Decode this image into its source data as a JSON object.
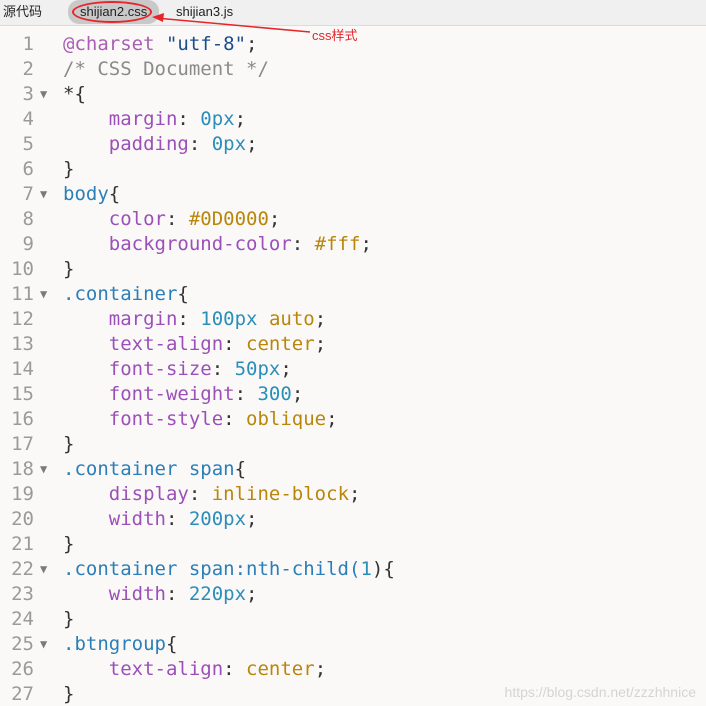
{
  "tabs": [
    {
      "label": "源代码",
      "active": false
    },
    {
      "label": "shijian2.css",
      "active": true
    },
    {
      "label": "shijian3.js",
      "active": false
    }
  ],
  "annotation": {
    "label": "css样式",
    "color": "#e5262b"
  },
  "watermark": "https://blog.csdn.net/zzzhhnice",
  "lines": [
    {
      "n": "1",
      "fold": false,
      "tokens": [
        {
          "t": "@charset ",
          "c": "at"
        },
        {
          "t": "\"utf-8\"",
          "c": "str"
        },
        {
          "t": ";",
          "c": "punc"
        }
      ]
    },
    {
      "n": "2",
      "fold": false,
      "tokens": [
        {
          "t": "/* CSS Document */",
          "c": "cmt"
        }
      ]
    },
    {
      "n": "3",
      "fold": true,
      "tokens": [
        {
          "t": "*{",
          "c": "punc"
        }
      ]
    },
    {
      "n": "4",
      "fold": false,
      "tokens": [
        {
          "t": "    margin",
          "c": "prop"
        },
        {
          "t": ": ",
          "c": "punc"
        },
        {
          "t": "0px",
          "c": "num"
        },
        {
          "t": ";",
          "c": "punc"
        }
      ]
    },
    {
      "n": "5",
      "fold": false,
      "tokens": [
        {
          "t": "    padding",
          "c": "prop"
        },
        {
          "t": ": ",
          "c": "punc"
        },
        {
          "t": "0px",
          "c": "num"
        },
        {
          "t": ";",
          "c": "punc"
        }
      ]
    },
    {
      "n": "6",
      "fold": false,
      "tokens": [
        {
          "t": "}",
          "c": "punc"
        }
      ]
    },
    {
      "n": "7",
      "fold": true,
      "tokens": [
        {
          "t": "body",
          "c": "sel"
        },
        {
          "t": "{",
          "c": "punc"
        }
      ]
    },
    {
      "n": "8",
      "fold": false,
      "tokens": [
        {
          "t": "    color",
          "c": "prop"
        },
        {
          "t": ": ",
          "c": "punc"
        },
        {
          "t": "#0D0000",
          "c": "kw"
        },
        {
          "t": ";",
          "c": "punc"
        }
      ]
    },
    {
      "n": "9",
      "fold": false,
      "tokens": [
        {
          "t": "    background-color",
          "c": "prop"
        },
        {
          "t": ": ",
          "c": "punc"
        },
        {
          "t": "#fff",
          "c": "kw"
        },
        {
          "t": ";",
          "c": "punc"
        }
      ]
    },
    {
      "n": "10",
      "fold": false,
      "tokens": [
        {
          "t": "}",
          "c": "punc"
        }
      ]
    },
    {
      "n": "11",
      "fold": true,
      "tokens": [
        {
          "t": ".container",
          "c": "sel"
        },
        {
          "t": "{",
          "c": "punc"
        }
      ]
    },
    {
      "n": "12",
      "fold": false,
      "tokens": [
        {
          "t": "    margin",
          "c": "prop"
        },
        {
          "t": ": ",
          "c": "punc"
        },
        {
          "t": "100px",
          "c": "num"
        },
        {
          "t": " ",
          "c": "punc"
        },
        {
          "t": "auto",
          "c": "kw"
        },
        {
          "t": ";",
          "c": "punc"
        }
      ]
    },
    {
      "n": "13",
      "fold": false,
      "tokens": [
        {
          "t": "    text-align",
          "c": "prop"
        },
        {
          "t": ": ",
          "c": "punc"
        },
        {
          "t": "center",
          "c": "kw"
        },
        {
          "t": ";",
          "c": "punc"
        }
      ]
    },
    {
      "n": "14",
      "fold": false,
      "tokens": [
        {
          "t": "    font-size",
          "c": "prop"
        },
        {
          "t": ": ",
          "c": "punc"
        },
        {
          "t": "50px",
          "c": "num"
        },
        {
          "t": ";",
          "c": "punc"
        }
      ]
    },
    {
      "n": "15",
      "fold": false,
      "tokens": [
        {
          "t": "    font-weight",
          "c": "prop"
        },
        {
          "t": ": ",
          "c": "punc"
        },
        {
          "t": "300",
          "c": "num"
        },
        {
          "t": ";",
          "c": "punc"
        }
      ]
    },
    {
      "n": "16",
      "fold": false,
      "tokens": [
        {
          "t": "    font-style",
          "c": "prop"
        },
        {
          "t": ": ",
          "c": "punc"
        },
        {
          "t": "oblique",
          "c": "kw"
        },
        {
          "t": ";",
          "c": "punc"
        }
      ]
    },
    {
      "n": "17",
      "fold": false,
      "tokens": [
        {
          "t": "}",
          "c": "punc"
        }
      ]
    },
    {
      "n": "18",
      "fold": true,
      "tokens": [
        {
          "t": ".container span",
          "c": "sel"
        },
        {
          "t": "{",
          "c": "punc"
        }
      ]
    },
    {
      "n": "19",
      "fold": false,
      "tokens": [
        {
          "t": "    display",
          "c": "prop"
        },
        {
          "t": ": ",
          "c": "punc"
        },
        {
          "t": "inline-block",
          "c": "kw"
        },
        {
          "t": ";",
          "c": "punc"
        }
      ]
    },
    {
      "n": "20",
      "fold": false,
      "tokens": [
        {
          "t": "    width",
          "c": "prop"
        },
        {
          "t": ": ",
          "c": "punc"
        },
        {
          "t": "200px",
          "c": "num"
        },
        {
          "t": ";",
          "c": "punc"
        }
      ]
    },
    {
      "n": "21",
      "fold": false,
      "tokens": [
        {
          "t": "}",
          "c": "punc"
        }
      ]
    },
    {
      "n": "22",
      "fold": true,
      "tokens": [
        {
          "t": ".container span",
          "c": "sel"
        },
        {
          "t": ":nth-child(",
          "c": "sel"
        },
        {
          "t": "1",
          "c": "num"
        },
        {
          "t": "){",
          "c": "punc"
        }
      ]
    },
    {
      "n": "23",
      "fold": false,
      "tokens": [
        {
          "t": "    width",
          "c": "prop"
        },
        {
          "t": ": ",
          "c": "punc"
        },
        {
          "t": "220px",
          "c": "num"
        },
        {
          "t": ";",
          "c": "punc"
        }
      ]
    },
    {
      "n": "24",
      "fold": false,
      "tokens": [
        {
          "t": "}",
          "c": "punc"
        }
      ]
    },
    {
      "n": "25",
      "fold": true,
      "tokens": [
        {
          "t": ".btngroup",
          "c": "sel"
        },
        {
          "t": "{",
          "c": "punc"
        }
      ]
    },
    {
      "n": "26",
      "fold": false,
      "tokens": [
        {
          "t": "    text-align",
          "c": "prop"
        },
        {
          "t": ": ",
          "c": "punc"
        },
        {
          "t": "center",
          "c": "kw"
        },
        {
          "t": ";",
          "c": "punc"
        }
      ]
    },
    {
      "n": "27",
      "fold": false,
      "tokens": [
        {
          "t": "}",
          "c": "punc"
        }
      ]
    }
  ]
}
